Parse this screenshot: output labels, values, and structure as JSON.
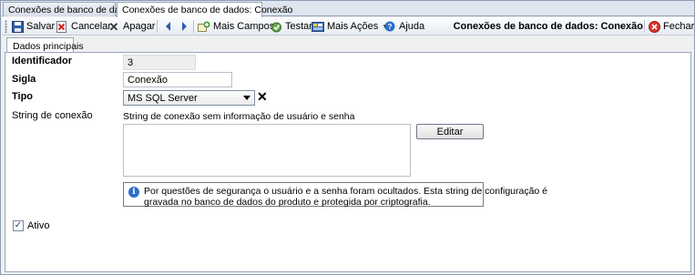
{
  "doc_tabs": [
    "Conexões de banco de dados",
    "Conexões de banco de dados: Conexão"
  ],
  "toolbar": {
    "save": "Salvar",
    "cancel": "Cancelar",
    "delete": "Apagar",
    "more_fields": "Mais Campos",
    "test": "Testar",
    "more_actions": "Mais Ações",
    "help": "Ajuda",
    "title": "Conexões de banco de dados: Conexão",
    "close": "Fechar"
  },
  "inner_tab": "Dados principais",
  "form": {
    "identificador_label": "Identificador",
    "identificador_value": "3",
    "sigla_label": "Sigla",
    "sigla_value": "Conexão",
    "tipo_label": "Tipo",
    "tipo_value": "MS SQL Server",
    "string_label": "String de conexão",
    "string_hint": "String de conexão sem informação de usuário e senha",
    "edit_button": "Editar",
    "info_line1": "Por questões de segurança o usuário e a senha foram ocultados. Esta string de configuração é",
    "info_line2": "gravada no banco de dados do produto e protegida por criptografia.",
    "ativo_label": "Ativo",
    "ativo_checked": true
  },
  "colors": {
    "accent": "#2a6fc9",
    "border": "#8a9bb4"
  }
}
